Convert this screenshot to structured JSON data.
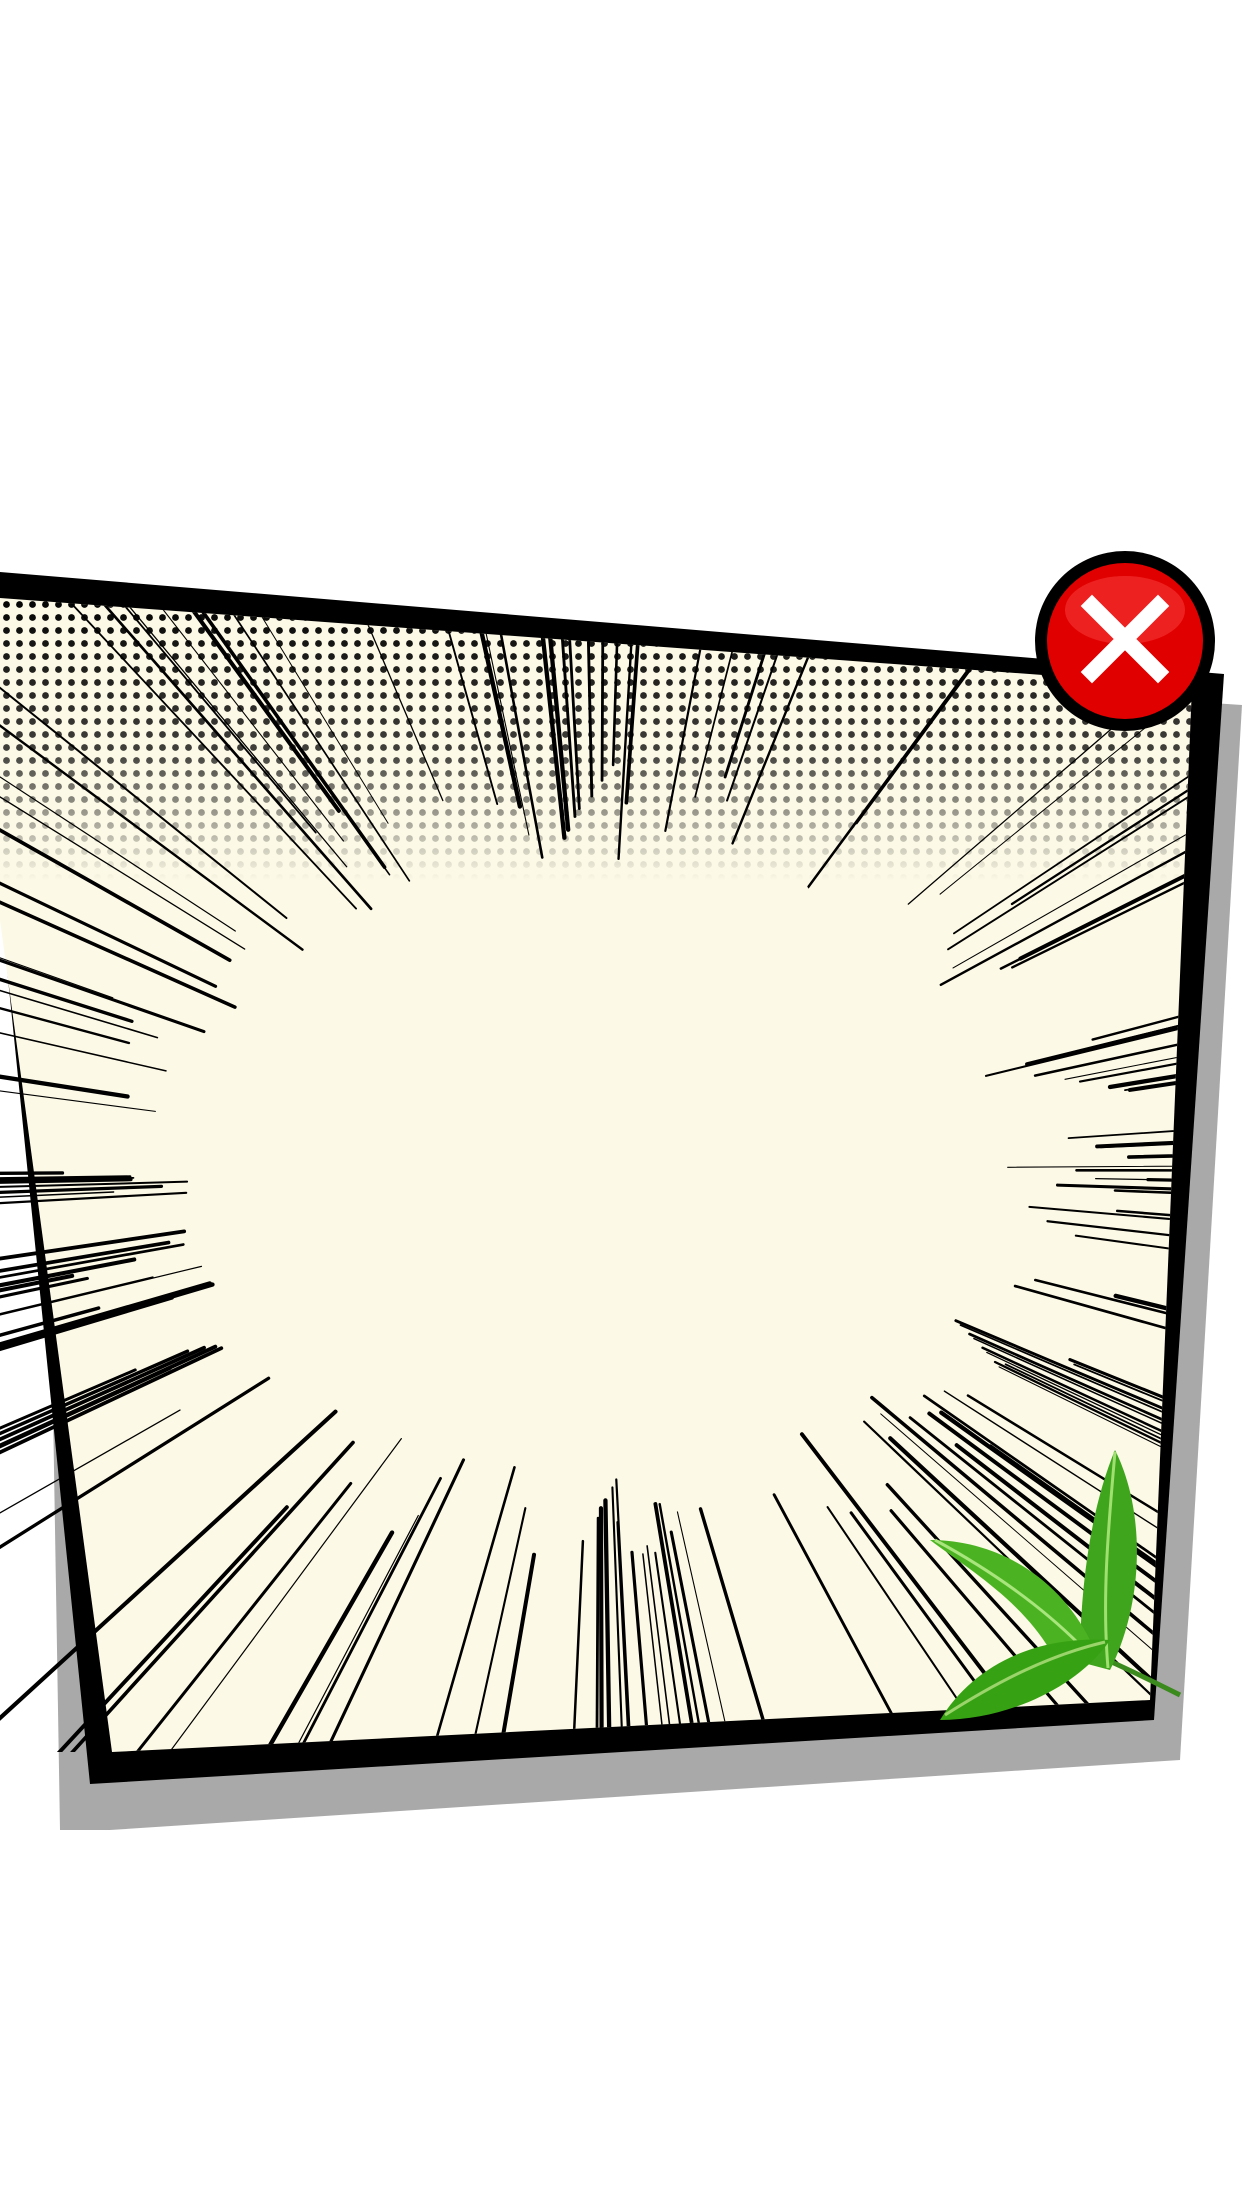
{
  "popup": {
    "background_color": "#FCF9E6",
    "border_color": "#000000",
    "shadow_color": "#9A9A9A",
    "style": "comic speed-lines with halftone dots",
    "decoration": "green-tea-leaves"
  },
  "close_button": {
    "icon": "close-icon",
    "fill_color": "#E00000",
    "ring_color": "#000000",
    "glyph_color": "#FFFFFF"
  }
}
